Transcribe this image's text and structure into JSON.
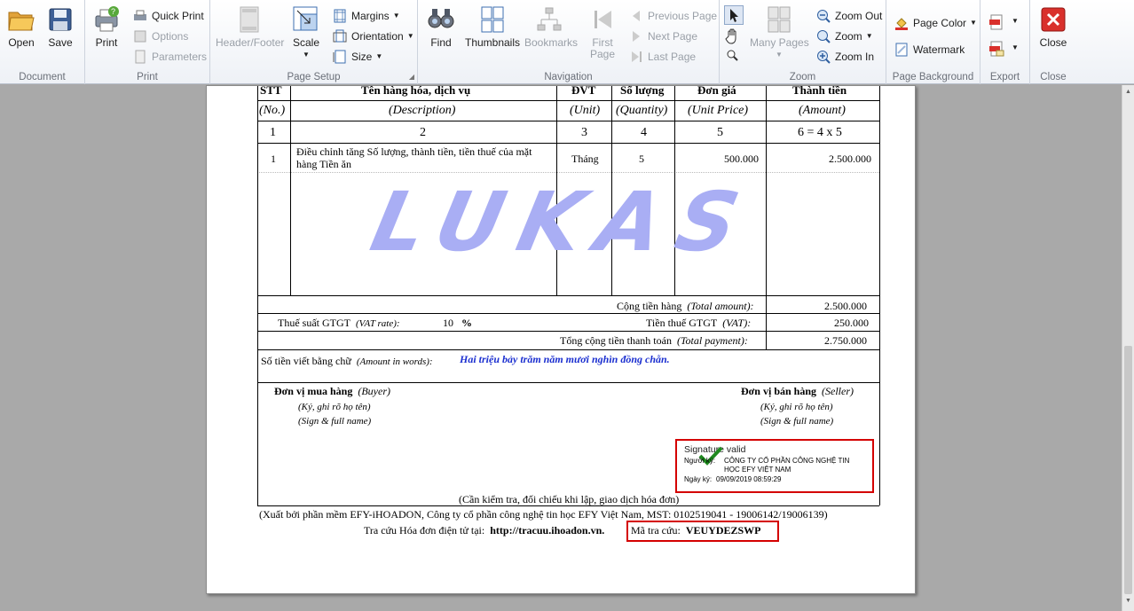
{
  "ribbon": {
    "document": {
      "caption": "Document",
      "open": "Open",
      "save": "Save"
    },
    "print": {
      "caption": "Print",
      "print": "Print",
      "quick_print": "Quick Print",
      "options": "Options",
      "parameters": "Parameters"
    },
    "page_setup": {
      "caption": "Page Setup",
      "header_footer": "Header/Footer",
      "scale": "Scale",
      "margins": "Margins",
      "orientation": "Orientation",
      "size": "Size"
    },
    "navigation": {
      "caption": "Navigation",
      "find": "Find",
      "thumbnails": "Thumbnails",
      "bookmarks": "Bookmarks",
      "first_page": "First Page",
      "previous_page": "Previous Page",
      "next_page": "Next Page",
      "last_page": "Last Page"
    },
    "zoom": {
      "caption": "Zoom",
      "many_pages": "Many Pages",
      "zoom_out": "Zoom Out",
      "zoom": "Zoom",
      "zoom_in": "Zoom In"
    },
    "page_background": {
      "caption": "Page Background",
      "page_color": "Page Color",
      "watermark": "Watermark"
    },
    "export": {
      "caption": "Export"
    },
    "close": {
      "caption": "Close",
      "close": "Close"
    }
  },
  "invoice": {
    "headers": {
      "stt": "STT",
      "stt_en": "(No.)",
      "desc": "Tên hàng hóa, dịch vụ",
      "desc_en": "(Description)",
      "unit": "ĐVT",
      "unit_en": "(Unit)",
      "qty": "Số lượng",
      "qty_en": "(Quantity)",
      "price": "Đơn giá",
      "price_en": "(Unit Price)",
      "amount": "Thành tiền",
      "amount_en": "(Amount)"
    },
    "col_index": [
      "1",
      "2",
      "3",
      "4",
      "5",
      "6 = 4 x 5"
    ],
    "item": {
      "no": "1",
      "desc_line1": "Điều chỉnh tăng Số lượng, thành tiền, tiền thuế của mặt",
      "desc_line2": "hàng Tiền ăn",
      "unit": "Tháng",
      "qty": "5",
      "price": "500.000",
      "amount": "2.500.000"
    },
    "watermark": "LUKAS",
    "total_amount_label": "Cộng tiền hàng",
    "total_amount_en": "(Total amount):",
    "total_amount": "2.500.000",
    "vat_rate_label": "Thuế suất GTGT",
    "vat_rate_en": "(VAT rate):",
    "vat_rate": "10",
    "vat_pct": "%",
    "vat_label": "Tiền thuế GTGT",
    "vat_en": "(VAT):",
    "vat": "250.000",
    "total_payment_label": "Tổng cộng tiền thanh toán",
    "total_payment_en": "(Total payment):",
    "total_payment": "2.750.000",
    "words_label": "Số tiền viết bằng chữ",
    "words_en": "(Amount in words):",
    "words": "Hai triệu bảy trăm năm mươi nghìn đồng chẵn.",
    "buyer": "Đơn vị mua hàng",
    "buyer_en": "(Buyer)",
    "seller": "Đơn vị bán hàng",
    "seller_en": "(Seller)",
    "sign_vi": "(Ký, ghi rõ họ tên)",
    "sign_en": "(Sign & full name)",
    "signature": {
      "title": "Signature valid",
      "signer_label": "Người ký:",
      "signer_line1": "CÔNG TY CỔ PHẦN CÔNG NGHỆ TIN",
      "signer_line2": "HỌC EFY VIỆT NAM",
      "date_label": "Ngày ký:",
      "date": "09/09/2019 08:59:29"
    },
    "check_note": "(Cần kiểm tra, đối chiếu khi lập, giao dịch hóa đơn)",
    "issuer_note": "(Xuất bởi phần mềm EFY-iHOADON, Công ty cổ phần công nghệ tin học EFY Việt Nam, MST: 0102519041 - 19006142/19006139)",
    "lookup_label": "Tra cứu Hóa đơn điện tử tại:",
    "lookup_url": "http://tracuu.ihoadon.vn.",
    "code_label": "Mã tra cứu:",
    "code": "VEUYDEZSWP"
  },
  "colors": {
    "accent_red": "#d40000",
    "watermark": "#a9aef4",
    "words_blue": "#1b2fd0",
    "check_green": "#1f8a1f",
    "close_red": "#d9302c"
  }
}
